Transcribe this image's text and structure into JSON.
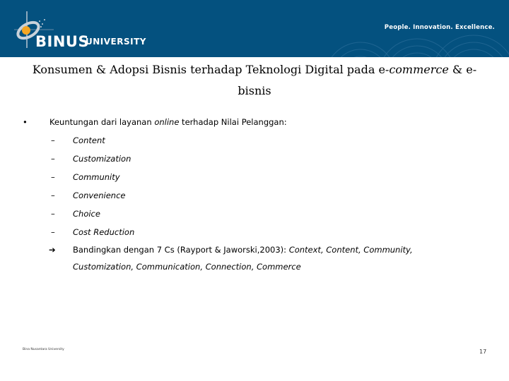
{
  "header": {
    "logo_main": "BINUS",
    "logo_sub": "UNIVERSITY",
    "tagline": "People. Innovation. Excellence.",
    "logo_icon": "binus-logo-icon",
    "colors": {
      "bar": "#04517f",
      "logo_dot": "#f5a623"
    }
  },
  "title": {
    "part1": "Konsumen & Adopsi Bisnis terhadap Teknologi Digital pada e-",
    "part_italic": "commerce",
    "part2": " & e-bisnis"
  },
  "content": {
    "bullet_symbol": "•",
    "main_point": {
      "before": "Keuntungan dari layanan ",
      "italic": "online",
      "after": " terhadap Nilai Pelanggan:"
    },
    "dash_symbol": "–",
    "sub_points": [
      "Content",
      "Customization",
      "Community",
      "Convenience",
      "Choice",
      "Cost Reduction"
    ],
    "arrow_symbol": "➔",
    "comparison": {
      "before": "Bandingkan dengan 7 Cs (Rayport & Jaworski,2003): ",
      "italic": "Context, Content, Community, Customization, Communication, Connection, Commerce"
    }
  },
  "footer": {
    "left": "Bina Nusantara University",
    "page_number": "17"
  }
}
